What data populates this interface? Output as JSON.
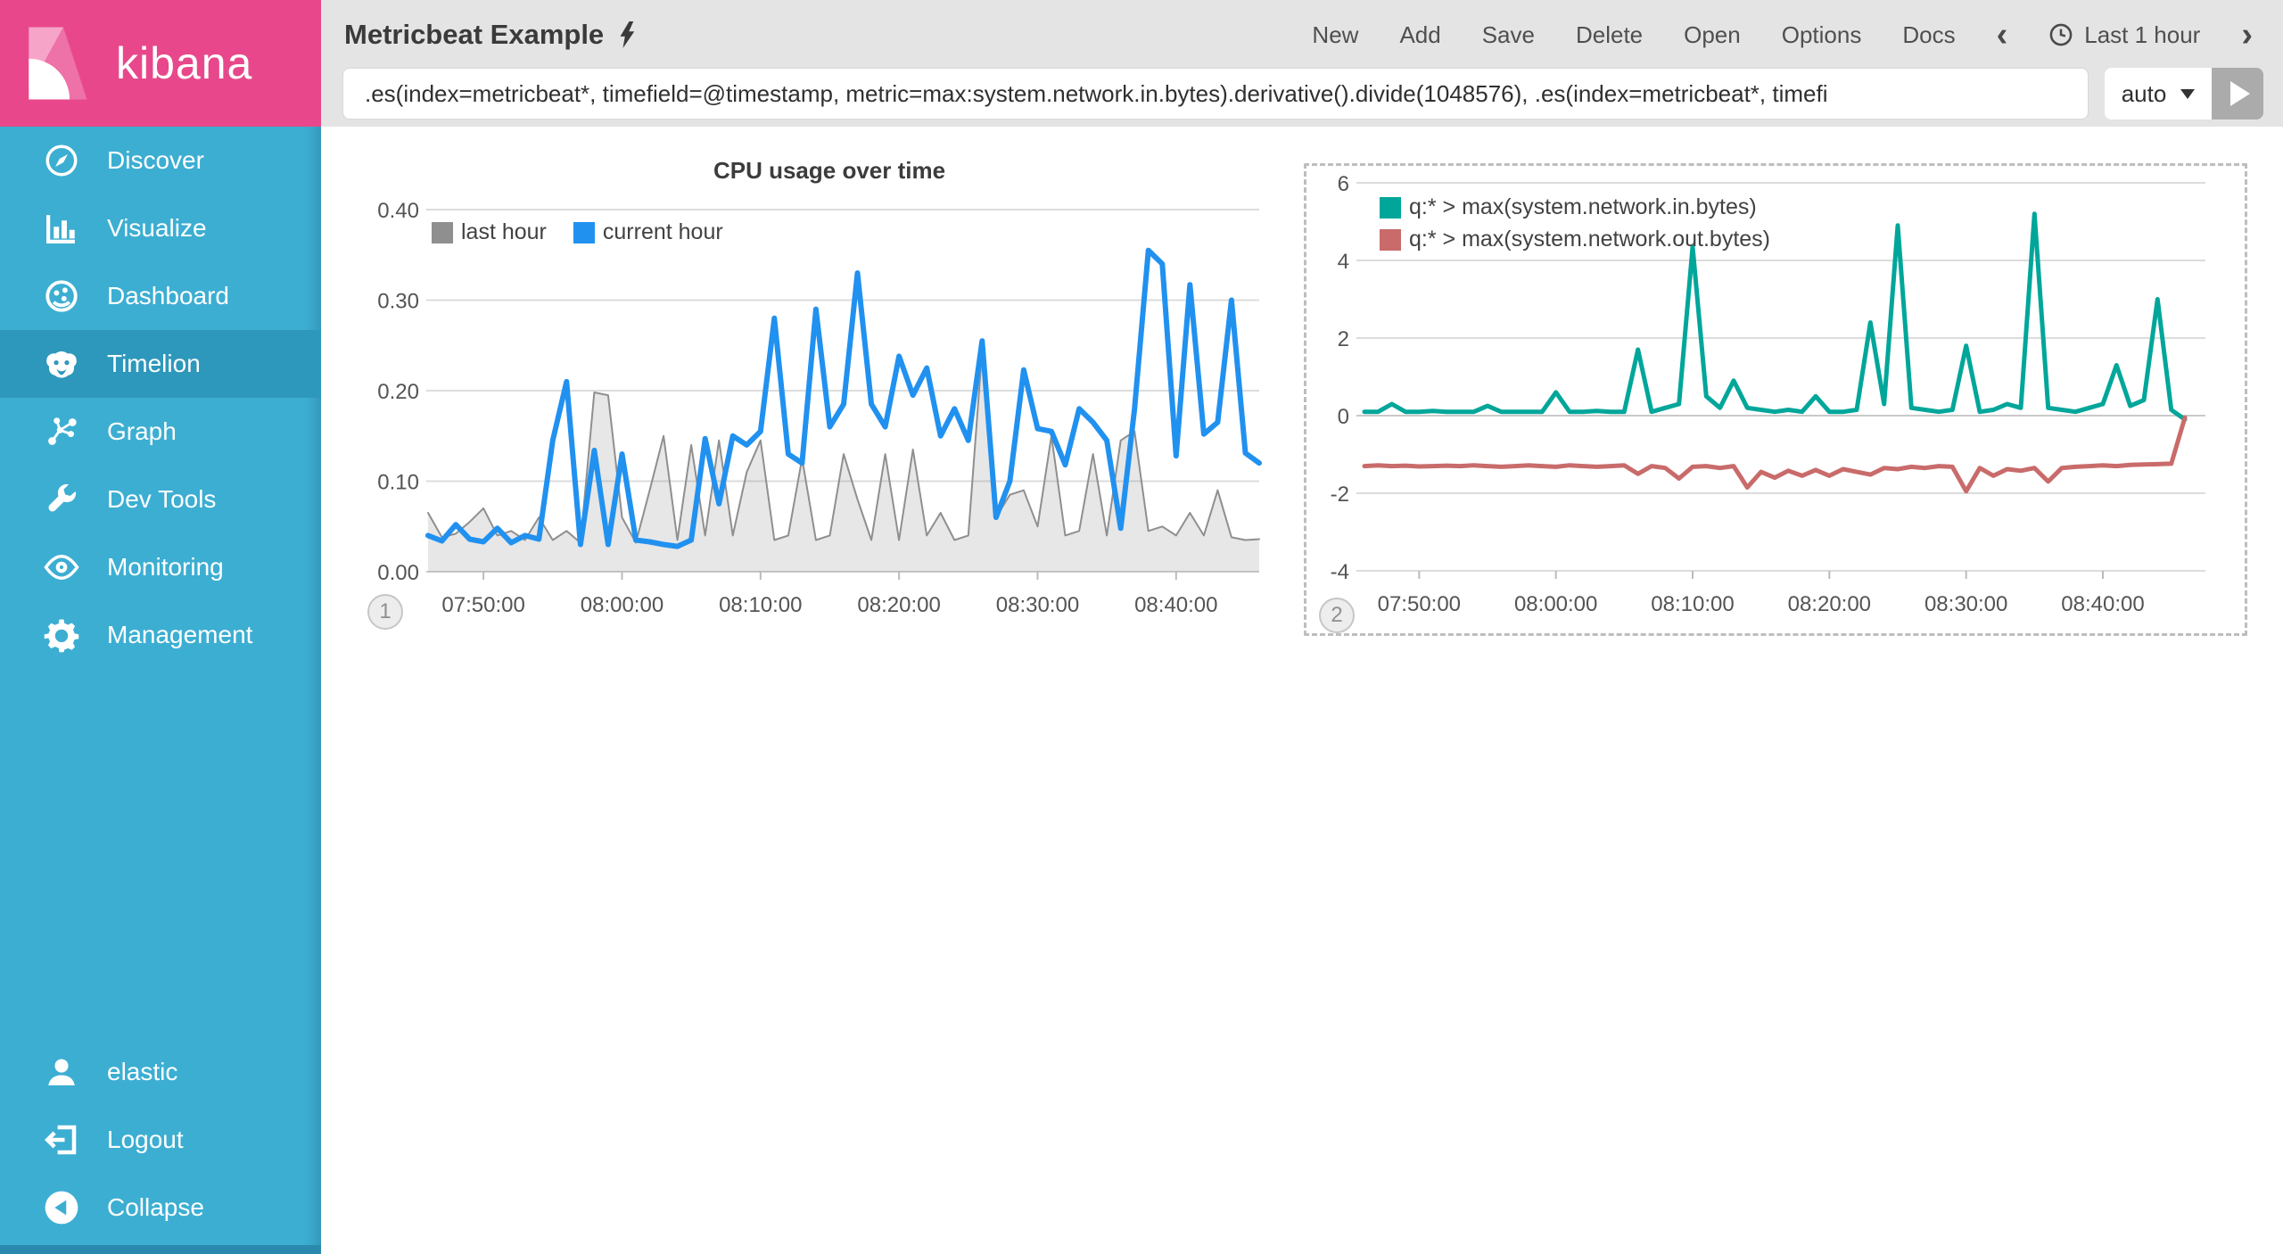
{
  "app": {
    "logo_text": "kibana"
  },
  "sidebar": {
    "items": [
      {
        "label": "Discover",
        "icon": "compass-icon",
        "selected": false
      },
      {
        "label": "Visualize",
        "icon": "bar-chart-icon",
        "selected": false
      },
      {
        "label": "Dashboard",
        "icon": "dashboard-icon",
        "selected": false
      },
      {
        "label": "Timelion",
        "icon": "lion-icon",
        "selected": true
      },
      {
        "label": "Graph",
        "icon": "graph-icon",
        "selected": false
      },
      {
        "label": "Dev Tools",
        "icon": "wrench-icon",
        "selected": false
      },
      {
        "label": "Monitoring",
        "icon": "eye-icon",
        "selected": false
      },
      {
        "label": "Management",
        "icon": "gear-icon",
        "selected": false
      }
    ],
    "footer_items": [
      {
        "label": "elastic",
        "icon": "user-icon"
      },
      {
        "label": "Logout",
        "icon": "logout-icon"
      },
      {
        "label": "Collapse",
        "icon": "collapse-icon"
      }
    ]
  },
  "topbar": {
    "title": "Metricbeat Example",
    "title_icon": "lightning-bolt-icon",
    "menu": [
      "New",
      "Add",
      "Save",
      "Delete",
      "Open",
      "Options",
      "Docs"
    ],
    "time_picker": {
      "prev_icon": "chevron-left-icon",
      "prev_glyph": "‹",
      "clock_icon": "clock-icon",
      "label": "Last 1 hour",
      "next_icon": "chevron-right-icon",
      "next_glyph": "›"
    },
    "query": {
      "value": ".es(index=metricbeat*, timefield=@timestamp, metric=max:system.network.in.bytes).derivative().divide(1048576), .es(index=metricbeat*, timefi",
      "interval": "auto",
      "run_icon": "play-icon"
    }
  },
  "colors": {
    "brand_pink": "#E8488B",
    "sidebar_blue": "#3CAED2",
    "sidebar_selected": "#2E97BC",
    "topbar_bg": "#E4E4E4",
    "series_blue": "#2191F0",
    "series_gray": "#8F8F8F",
    "series_teal": "#00A69A",
    "series_red": "#C96B6B"
  },
  "chart_data": [
    {
      "type": "line",
      "title": "CPU usage over time",
      "badge": "1",
      "x_start": "07:46:00",
      "x_step_minutes": 1,
      "x_ticks": {
        "labels": [
          "07:50:00",
          "08:00:00",
          "08:10:00",
          "08:20:00",
          "08:30:00",
          "08:40:00"
        ],
        "offsets": [
          4,
          14,
          24,
          34,
          44,
          54
        ]
      },
      "y_ticks": [
        "0.00",
        "0.10",
        "0.20",
        "0.30",
        "0.40"
      ],
      "ylim": [
        0,
        0.4
      ],
      "grid": true,
      "legend_position": "top-left",
      "series": [
        {
          "name": "last hour",
          "color": "#8F8F8F",
          "fill": "rgba(145,145,145,0.22)",
          "line_width": 2,
          "values": [
            0.065,
            0.038,
            0.042,
            0.055,
            0.07,
            0.04,
            0.045,
            0.035,
            0.06,
            0.035,
            0.045,
            0.032,
            0.198,
            0.195,
            0.06,
            0.032,
            0.09,
            0.15,
            0.035,
            0.14,
            0.04,
            0.145,
            0.04,
            0.11,
            0.145,
            0.035,
            0.04,
            0.125,
            0.035,
            0.04,
            0.13,
            0.08,
            0.035,
            0.13,
            0.035,
            0.135,
            0.04,
            0.065,
            0.035,
            0.04,
            0.245,
            0.06,
            0.085,
            0.09,
            0.05,
            0.15,
            0.04,
            0.045,
            0.13,
            0.04,
            0.145,
            0.155,
            0.045,
            0.05,
            0.04,
            0.065,
            0.04,
            0.09,
            0.038,
            0.035,
            0.036
          ]
        },
        {
          "name": "current hour",
          "color": "#2191F0",
          "line_width": 6,
          "values": [
            0.04,
            0.034,
            0.052,
            0.036,
            0.033,
            0.048,
            0.032,
            0.04,
            0.036,
            0.145,
            0.21,
            0.03,
            0.134,
            0.03,
            0.13,
            0.035,
            0.033,
            0.03,
            0.028,
            0.035,
            0.147,
            0.075,
            0.15,
            0.14,
            0.155,
            0.28,
            0.13,
            0.12,
            0.29,
            0.16,
            0.185,
            0.33,
            0.185,
            0.16,
            0.238,
            0.195,
            0.225,
            0.15,
            0.18,
            0.145,
            0.255,
            0.06,
            0.1,
            0.223,
            0.158,
            0.155,
            0.118,
            0.18,
            0.165,
            0.145,
            0.048,
            0.18,
            0.355,
            0.34,
            0.128,
            0.317,
            0.152,
            0.165,
            0.3,
            0.131,
            0.12
          ]
        }
      ]
    },
    {
      "type": "line",
      "title": "",
      "badge": "2",
      "x_start": "07:46:00",
      "x_step_minutes": 1,
      "x_ticks": {
        "labels": [
          "07:50:00",
          "08:00:00",
          "08:10:00",
          "08:20:00",
          "08:30:00",
          "08:40:00"
        ],
        "offsets": [
          4,
          14,
          24,
          34,
          44,
          54
        ]
      },
      "y_ticks": [
        "6",
        "4",
        "2",
        "0",
        "-2",
        "-4"
      ],
      "ylim": [
        -4,
        6
      ],
      "grid": true,
      "legend_position": "top-left",
      "selected": true,
      "series": [
        {
          "name": "q:* > max(system.network.in.bytes)",
          "color": "#00A69A",
          "line_width": 5,
          "values": [
            0.1,
            0.1,
            0.3,
            0.1,
            0.1,
            0.12,
            0.1,
            0.1,
            0.1,
            0.25,
            0.1,
            0.1,
            0.1,
            0.1,
            0.6,
            0.1,
            0.1,
            0.12,
            0.1,
            0.1,
            1.7,
            0.1,
            0.2,
            0.3,
            4.35,
            0.5,
            0.2,
            0.9,
            0.2,
            0.15,
            0.1,
            0.15,
            0.1,
            0.5,
            0.1,
            0.1,
            0.15,
            2.4,
            0.3,
            4.9,
            0.2,
            0.15,
            0.1,
            0.15,
            1.8,
            0.1,
            0.15,
            0.3,
            0.2,
            5.2,
            0.2,
            0.15,
            0.1,
            0.2,
            0.3,
            1.3,
            0.25,
            0.4,
            3.0,
            0.15,
            -0.1
          ]
        },
        {
          "name": "q:* > max(system.network.out.bytes)",
          "color": "#C96B6B",
          "line_width": 5,
          "values": [
            -1.3,
            -1.28,
            -1.3,
            -1.29,
            -1.31,
            -1.3,
            -1.29,
            -1.3,
            -1.28,
            -1.3,
            -1.32,
            -1.3,
            -1.28,
            -1.3,
            -1.32,
            -1.28,
            -1.3,
            -1.32,
            -1.3,
            -1.28,
            -1.5,
            -1.3,
            -1.35,
            -1.62,
            -1.32,
            -1.3,
            -1.35,
            -1.3,
            -1.85,
            -1.45,
            -1.6,
            -1.42,
            -1.55,
            -1.4,
            -1.55,
            -1.38,
            -1.45,
            -1.52,
            -1.35,
            -1.38,
            -1.32,
            -1.35,
            -1.3,
            -1.32,
            -1.95,
            -1.35,
            -1.55,
            -1.38,
            -1.42,
            -1.35,
            -1.7,
            -1.35,
            -1.32,
            -1.3,
            -1.28,
            -1.3,
            -1.27,
            -1.26,
            -1.25,
            -1.24,
            -0.05
          ]
        }
      ]
    }
  ]
}
